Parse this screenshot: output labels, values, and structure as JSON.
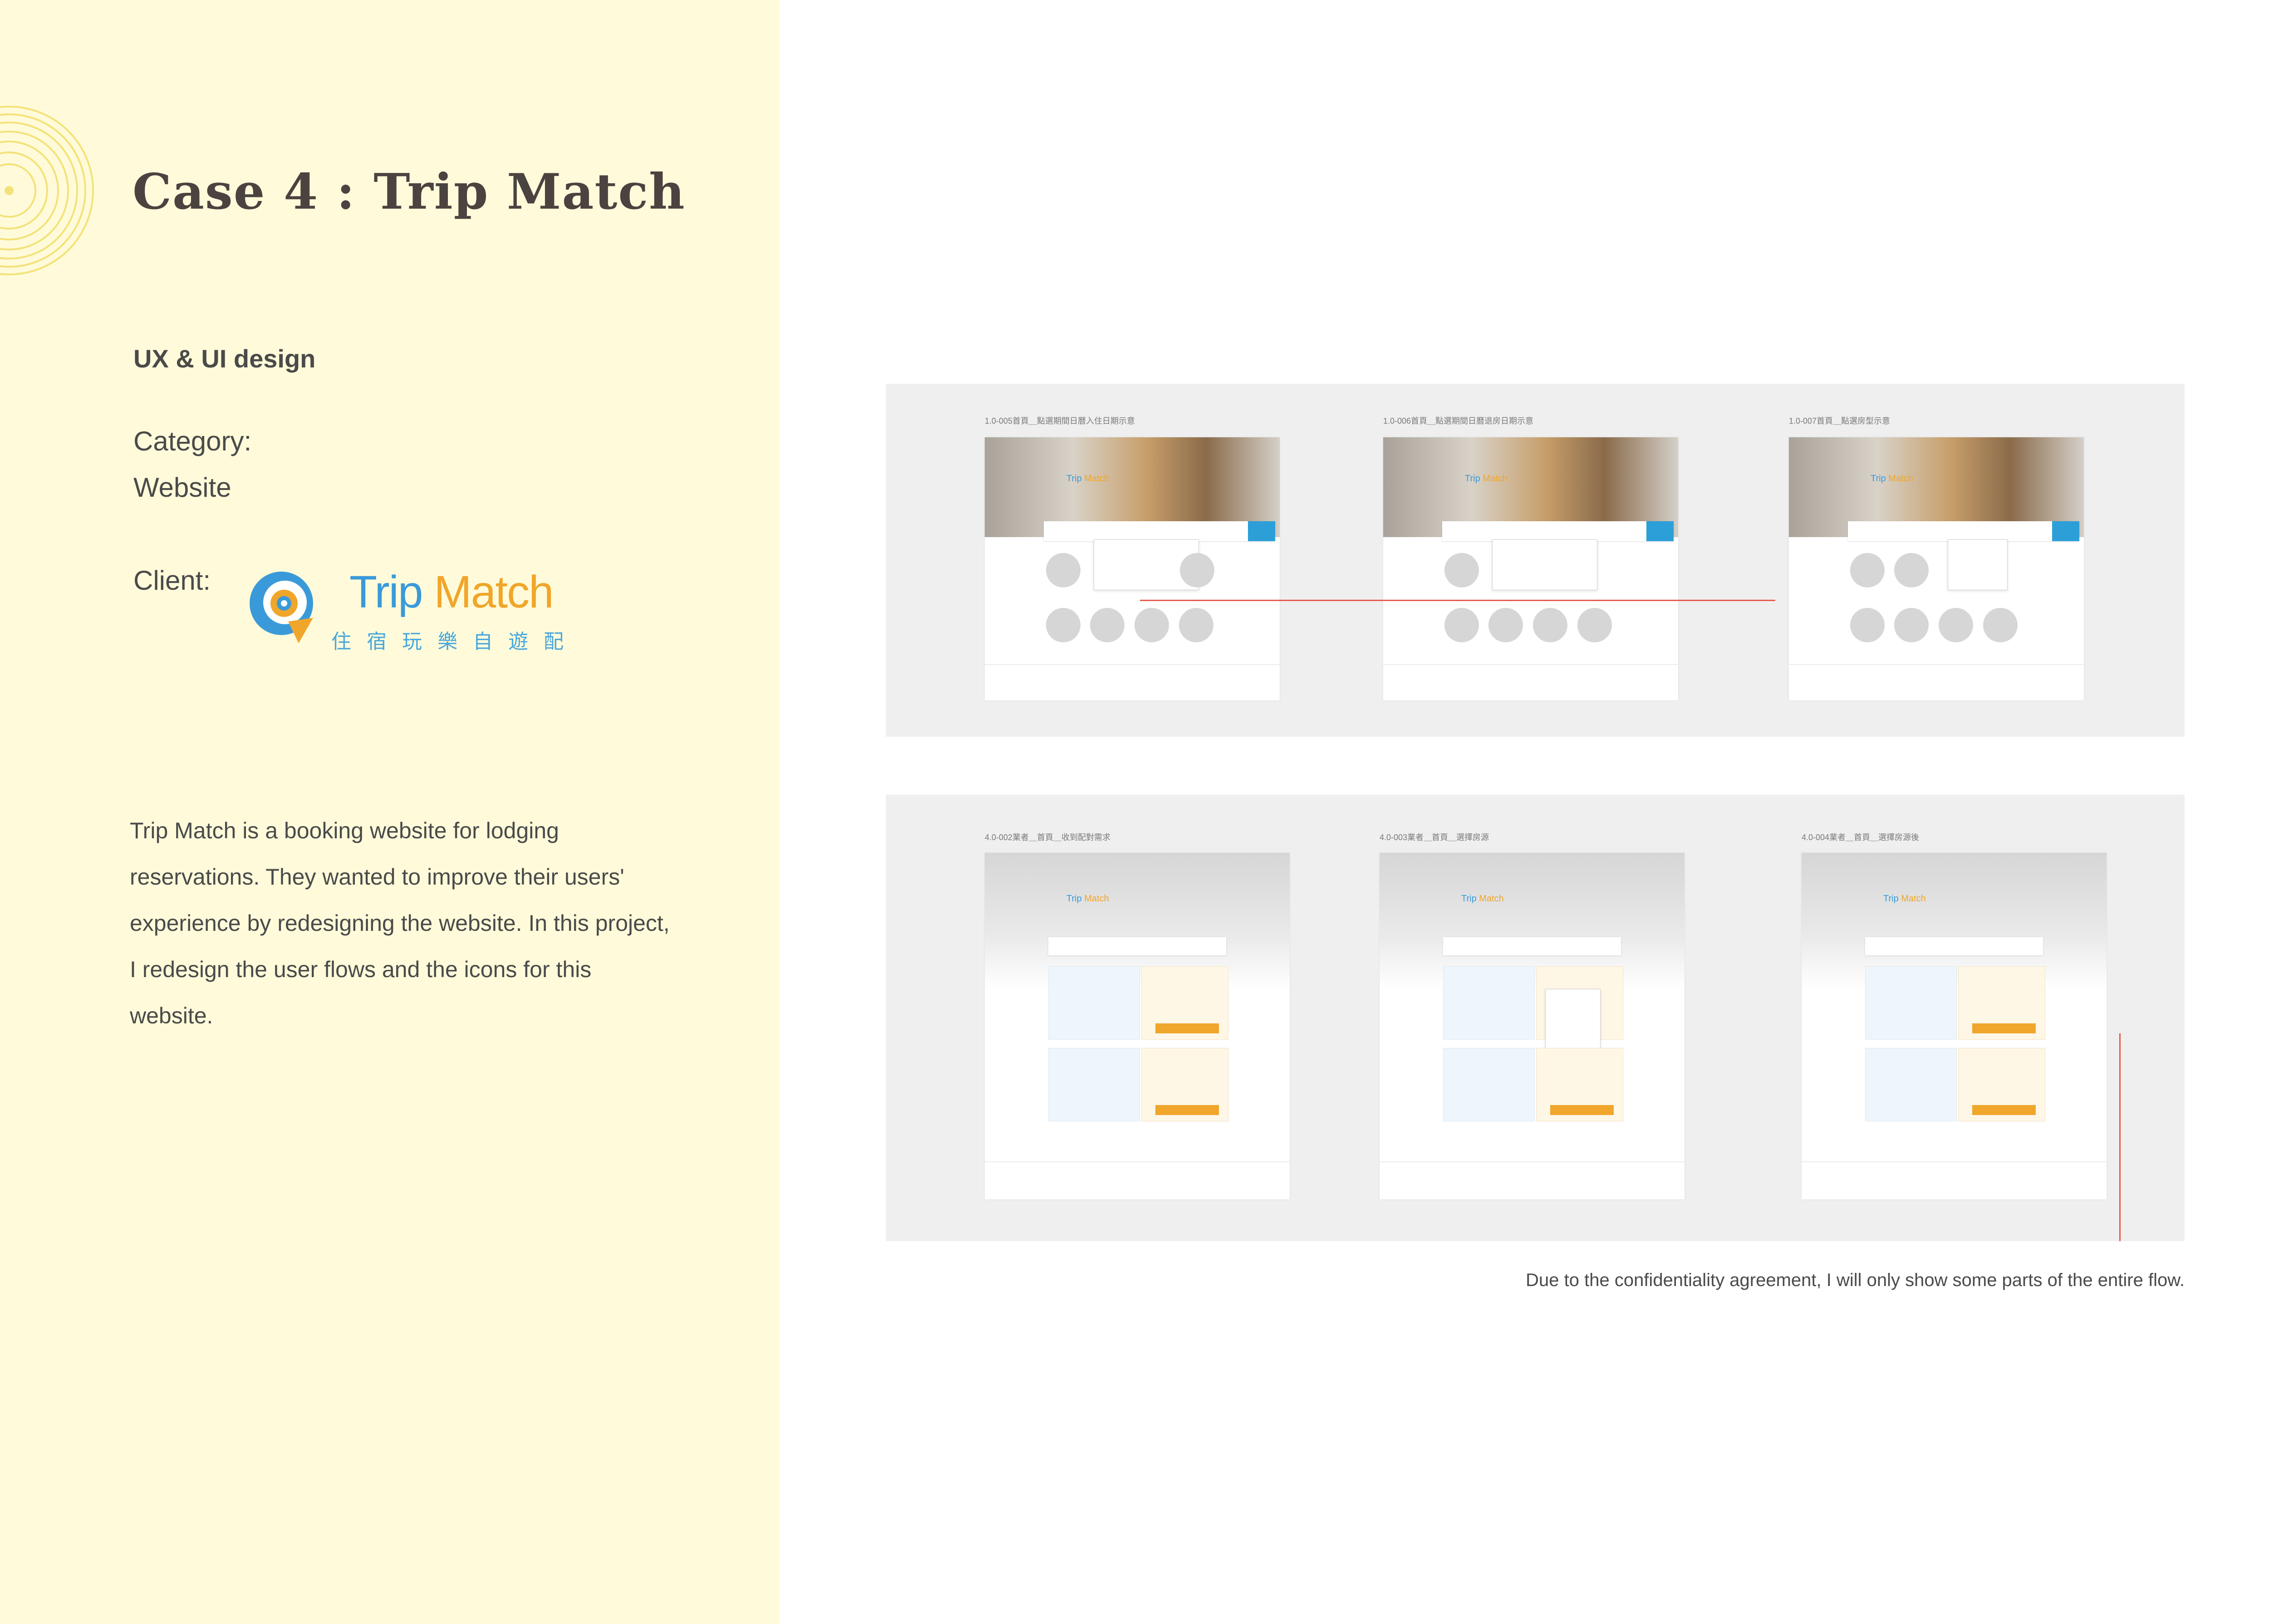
{
  "case_title": "Case 4 : Trip Match",
  "role": "UX & UI design",
  "category": {
    "label": "Category:",
    "value": "Website"
  },
  "client": {
    "label": "Client:",
    "logo_word_trip": "Trip ",
    "logo_word_match": "Match",
    "logo_subtitle": "住宿玩樂自遊配"
  },
  "description": "Trip Match is a booking website for lodging reservations. They wanted to improve their users' experience by redesigning the website. In this project, I redesign the user flows and the icons for this website.",
  "gallery_top": {
    "screens": [
      {
        "caption": "1.0-005首頁＿點選期間日曆入住日期示意"
      },
      {
        "caption": "1.0-006首頁＿點選期間日曆退房日期示意"
      },
      {
        "caption": "1.0-007首頁＿點選房型示意"
      }
    ]
  },
  "gallery_bottom": {
    "screens": [
      {
        "caption": "4.0-002業者＿首頁＿收到配對需求"
      },
      {
        "caption": "4.0-003業者＿首頁＿選擇房源"
      },
      {
        "caption": "4.0-004業者＿首頁＿選擇房源後"
      }
    ]
  },
  "disclaimer": "Due to the confidentiality agreement, I will only show some parts of the entire flow.",
  "colors": {
    "left_panel": "#fffbda",
    "brand_blue": "#3a9ad9",
    "brand_orange": "#f0a62a",
    "gallery_bg": "#efefef"
  }
}
